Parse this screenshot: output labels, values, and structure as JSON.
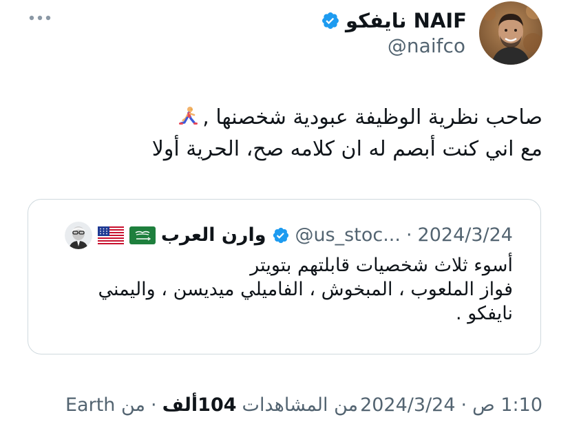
{
  "tweet": {
    "author_name": "نايفكو NAIF",
    "handle": "@naifco",
    "text_lines": [
      "صاحب نظرية الوظيفة عبودية شخصنها ,",
      "مع اني كنت أبصم له ان كلامه صح، الحرية أولا"
    ],
    "emoji": "runner-emoji"
  },
  "quoted": {
    "name": "وارن العرب",
    "flags": [
      "saudi-flag",
      "us-flag"
    ],
    "handle": "@us_stoc...",
    "separator": "·",
    "date": "2024/3/24",
    "text_lines": [
      "أسوء ثلاث شخصيات قابلتهم بتويتر",
      "فواز الملعوب ،  المبخوش ، الفاميلي ميديسن ، واليمني",
      "نايفكو ."
    ]
  },
  "meta": {
    "time": "1:10 ص",
    "from": "من Earth",
    "separator": "·",
    "date": "2024/3/24",
    "views_count": "104ألف",
    "views_label": "من المشاهدات"
  },
  "colors": {
    "text": "#0f1419",
    "muted": "#536471",
    "verified": "#1d9bf0",
    "border": "#cfd9de"
  }
}
